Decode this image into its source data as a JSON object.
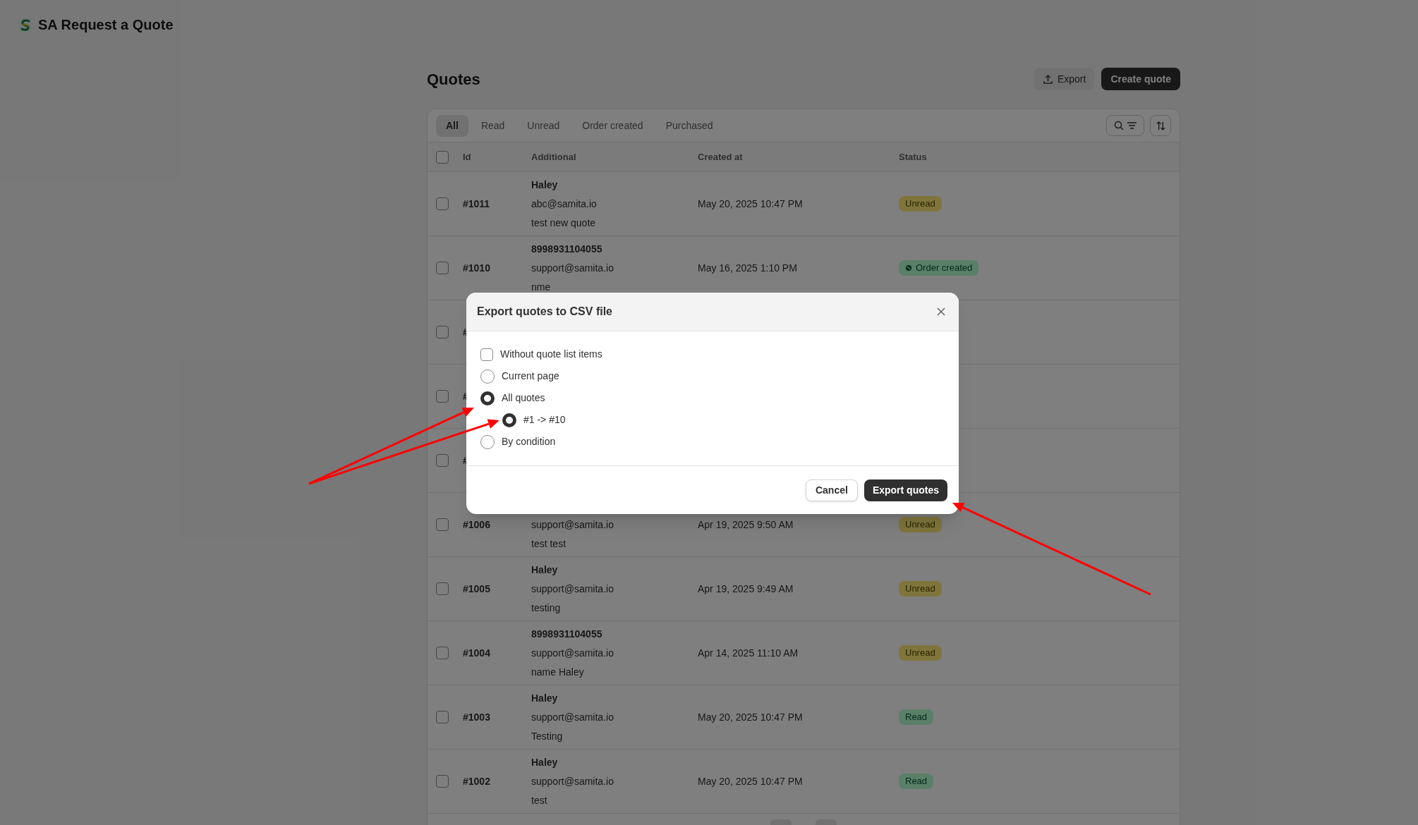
{
  "app": {
    "title": "SA Request a Quote"
  },
  "page": {
    "title": "Quotes",
    "actions": [
      {
        "label": "Export",
        "kind": "secondary"
      },
      {
        "label": "Create quote",
        "kind": "primary"
      }
    ]
  },
  "tabs": [
    {
      "label": "All",
      "selected": true
    },
    {
      "label": "Read",
      "selected": false
    },
    {
      "label": "Unread",
      "selected": false
    },
    {
      "label": "Order created",
      "selected": false
    },
    {
      "label": "Purchased",
      "selected": false
    }
  ],
  "table": {
    "select_all_checked": false,
    "columns": [
      "Id",
      "Additional",
      "Created at",
      "Status"
    ],
    "rows": [
      {
        "checked": false,
        "id": "#1011",
        "name": "Haley",
        "email": "abc@samita.io",
        "note": "test new quote",
        "created": "May 20, 2025 10:47 PM",
        "status": {
          "label": "Unread",
          "kind": "unread"
        }
      },
      {
        "checked": false,
        "id": "#1010",
        "name": "8998931104055",
        "email": "support@samita.io",
        "note": "nme",
        "created": "May 16, 2025 1:10 PM",
        "status": {
          "label": "Order created",
          "kind": "order"
        }
      },
      {
        "checked": false,
        "id": "#"
      },
      {
        "checked": false,
        "id": "#"
      },
      {
        "checked": false,
        "id": "#"
      },
      {
        "checked": false,
        "id": "#1006",
        "email": "support@samita.io",
        "note": "test test",
        "created": "Apr 19, 2025 9:50 AM",
        "status": {
          "label": "Unread",
          "kind": "unread"
        }
      },
      {
        "checked": false,
        "id": "#1005",
        "name": "Haley",
        "email": "support@samita.io",
        "note": "testing",
        "created": "Apr 19, 2025 9:49 AM",
        "status": {
          "label": "Unread",
          "kind": "unread"
        }
      },
      {
        "checked": false,
        "id": "#1004",
        "name": "8998931104055",
        "email": "support@samita.io",
        "note": "name Haley",
        "created": "Apr 14, 2025 11:10 AM",
        "status": {
          "label": "Unread",
          "kind": "unread"
        }
      },
      {
        "checked": false,
        "id": "#1003",
        "name": "Haley",
        "email": "support@samita.io",
        "note": "Testing",
        "created": "May 20, 2025 10:47 PM",
        "status": {
          "label": "Read",
          "kind": "read"
        }
      },
      {
        "checked": false,
        "id": "#1002",
        "name": "Haley",
        "email": "support@samita.io",
        "note": "test",
        "created": "May 20, 2025 10:47 PM",
        "status": {
          "label": "Read",
          "kind": "read"
        }
      }
    ]
  },
  "dialog": {
    "title": "Export quotes to CSV file",
    "options": [
      {
        "kind": "checkbox",
        "label": "Without quote list items",
        "checked": false
      },
      {
        "kind": "radio",
        "label": "Current page",
        "selected": false
      },
      {
        "kind": "radio",
        "label": "All quotes",
        "selected": true,
        "children": [
          {
            "kind": "radio",
            "label": "#1 -> #10",
            "selected": true
          }
        ]
      },
      {
        "kind": "radio",
        "label": "By condition",
        "selected": false
      }
    ],
    "buttons": [
      {
        "label": "Cancel",
        "kind": "secondary"
      },
      {
        "label": "Export quotes",
        "kind": "primary"
      }
    ]
  }
}
